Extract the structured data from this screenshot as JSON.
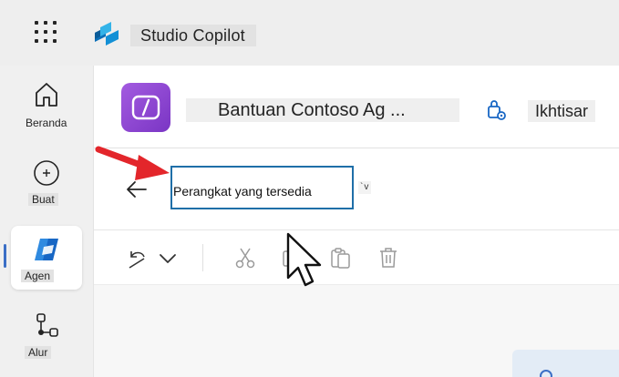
{
  "topbar": {
    "app_title": "Studio Copilot",
    "app_launcher_icon": "waffle-grid-icon",
    "app_logo_icon": "copilot-studio-logo"
  },
  "sidebar": {
    "items": [
      {
        "label": "Beranda",
        "icon": "home-icon"
      },
      {
        "label": "Buat",
        "icon": "plus-circle-icon"
      },
      {
        "label": "Agen",
        "icon": "agent-icon",
        "active": true
      },
      {
        "label": "Alur",
        "icon": "flow-icon"
      }
    ]
  },
  "header": {
    "agent_name": "Bantuan Contoso Ag ...",
    "overview_label": "Ikhtisar",
    "agent_icon": "code-brackets-icon",
    "settings_icon": "key-gear-icon"
  },
  "editor": {
    "back_icon": "arrow-left-icon",
    "name_value": "Perangkat yang tersedia",
    "chevron_label": "`v"
  },
  "toolbar": {
    "icons": [
      "undo-icon",
      "chevron-down-icon",
      "cut-icon",
      "copy-icon",
      "paste-icon",
      "delete-icon"
    ]
  },
  "colors": {
    "accent": "#1f6fa8",
    "agent_logo": "#8a43d0",
    "arrow": "#e3262b",
    "nav_indicator": "#3b6fc6"
  }
}
